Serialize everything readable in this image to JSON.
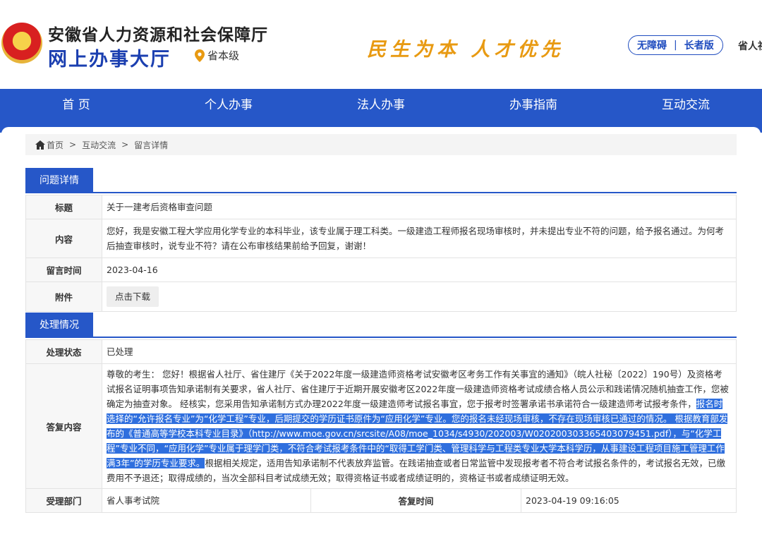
{
  "header": {
    "title_line1": "安徽省人力资源和社会保障厅",
    "title_line2": "网上办事大厅",
    "level": "省本级",
    "slogan": "民生为本 人才优先",
    "accessibility": "无障碍",
    "elderly": "长者版",
    "province": "省人社"
  },
  "nav": [
    "首 页",
    "个人办事",
    "法人办事",
    "办事指南",
    "互动交流"
  ],
  "breadcrumb": [
    "首页",
    "互动交流",
    "留言详情"
  ],
  "question": {
    "section_title": "问题详情",
    "title_label": "标题",
    "title_value": "关于一建考后资格审查问题",
    "content_label": "内容",
    "content_value": "您好，我是安徽工程大学应用化学专业的本科毕业，该专业属于理工科类。一级建造工程师报名现场审核时，并未提出专业不符的问题，给予报名通过。为何考后抽查审核时，说专业不符？请在公布审核结果前给予回复，谢谢！",
    "time_label": "留言时间",
    "time_value": "2023-04-16",
    "attach_label": "附件",
    "attach_button": "点击下载"
  },
  "handling": {
    "section_title": "处理情况",
    "status_label": "处理状态",
    "status_value": "已处理",
    "reply_label": "答复内容",
    "reply_part1": "尊敬的考生： 您好！根据省人社厅、省住建厅《关于2022年度一级建造师资格考试安徽考区考务工作有关事宜的通知》（皖人社秘〔2022〕190号）及资格考试报名证明事项告知承诺制有关要求，省人社厅、省住建厅于近期开展安徽考区2022年度一级建造师资格考试成绩合格人员公示和践诺情况随机抽查工作，您被确定为抽查对象。 经核实，您采用告知承诺制方式办理2022年度一级建造师考试报名事宜，您于报考时签署承诺书承诺符合一级建造师考试报考条件，",
    "reply_highlight": "报名时选择的“允许报名专业”为“化学工程”专业，后期提交的学历证书原件为“应用化学”专业。您的报名未经现场审核，不存在现场审核已通过的情况。 根据教育部发布的《普通高等学校本科专业目录》（http://www.moe.gov.cn/srcsite/A08/moe_1034/s4930/202003/W020200303365403079451.pdf），与“化学工程”专业不同，“应用化学”专业属于理学门类，不符合考试报考条件中的“取得工学门类、管理科学与工程类专业大学本科学历，从事建设工程项目施工管理工作满3年”的学历专业要求。",
    "reply_part2": "根据相关规定，适用告知承诺制不代表放弃监管。在践诺抽查或者日常监管中发现报考者不符合考试报名条件的，考试报名无效，已缴费用不予退还；取得成绩的，当次全部科目考试成绩无效；取得资格证书或者成绩证明的，资格证书或者成绩证明无效。",
    "dept_label": "受理部门",
    "dept_value": "省人事考试院",
    "reply_time_label": "答复时间",
    "reply_time_value": "2023-04-19 09:16:05"
  },
  "colors": {
    "primary": "#2657c8",
    "slogan": "#e89a12",
    "highlight": "#2f6fde"
  }
}
